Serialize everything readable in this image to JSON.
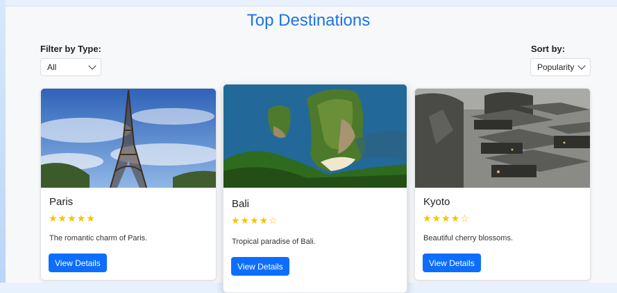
{
  "page": {
    "title": "Top Destinations"
  },
  "filter": {
    "label": "Filter by Type:",
    "value": "All"
  },
  "sort": {
    "label": "Sort by:",
    "value": "Popularity"
  },
  "colors": {
    "accent": "#1a73e8",
    "button": "#0d6efd",
    "star": "#f6c300"
  },
  "destinations": [
    {
      "name": "Paris",
      "rating": 5,
      "stars": "★★★★★",
      "description": "The romantic charm of Paris.",
      "button_label": "View Details",
      "image": "eiffel-tower-photo"
    },
    {
      "name": "Bali",
      "rating": 4,
      "stars": "★★★★☆",
      "description": "Tropical paradise of Bali.",
      "button_label": "View Details",
      "image": "bali-cliff-beach-photo"
    },
    {
      "name": "Kyoto",
      "rating": 4,
      "stars": "★★★★☆",
      "description": "Beautiful cherry blossoms.",
      "button_label": "View Details",
      "image": "kyoto-rooftops-photo"
    }
  ]
}
